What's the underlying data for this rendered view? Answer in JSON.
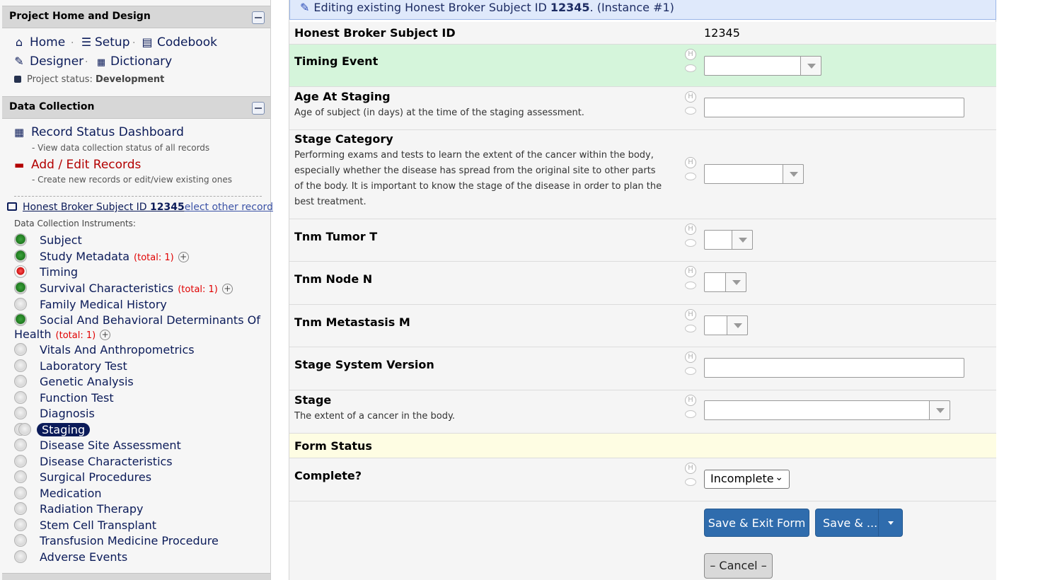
{
  "sidebar": {
    "project_header": "Project Home and Design",
    "links": {
      "home": "Home",
      "setup": "Setup",
      "codebook": "Codebook",
      "designer": "Designer",
      "dictionary": "Dictionary"
    },
    "separator": "·",
    "project_status_label": "Project status:",
    "project_status_value": "Development",
    "data_collection_header": "Data Collection",
    "record_status_dashboard": "Record Status Dashboard",
    "record_status_desc": "- View data collection status of all records",
    "add_edit_records": "Add / Edit Records",
    "add_edit_desc": "- Create new records or edit/view existing ones",
    "record_link_prefix": "Honest Broker Subject ID ",
    "record_id": "12345",
    "select_other": "elect other record",
    "instruments_caption": "Data Collection Instruments:",
    "instruments": [
      {
        "name": "Subject",
        "status": "green",
        "total": ""
      },
      {
        "name": "Study Metadata",
        "status": "green",
        "total": "(total: 1)"
      },
      {
        "name": "Timing",
        "status": "red",
        "total": ""
      },
      {
        "name": "Survival Characteristics",
        "status": "green",
        "total": "(total: 1)"
      },
      {
        "name": "Family Medical History",
        "status": "grey",
        "total": ""
      },
      {
        "name": "Social And Behavioral Determinants Of",
        "name2": "Health",
        "status": "green",
        "total": "(total: 1)"
      },
      {
        "name": "Vitals And Anthropometrics",
        "status": "grey",
        "total": ""
      },
      {
        "name": "Laboratory Test",
        "status": "grey",
        "total": ""
      },
      {
        "name": "Genetic Analysis",
        "status": "grey",
        "total": ""
      },
      {
        "name": "Function Test",
        "status": "grey",
        "total": ""
      },
      {
        "name": "Diagnosis",
        "status": "grey",
        "total": ""
      },
      {
        "name": "Staging",
        "status": "grey-active",
        "total": ""
      },
      {
        "name": "Disease Site Assessment",
        "status": "grey",
        "total": ""
      },
      {
        "name": "Disease Characteristics",
        "status": "grey",
        "total": ""
      },
      {
        "name": "Surgical Procedures",
        "status": "grey",
        "total": ""
      },
      {
        "name": "Medication",
        "status": "grey",
        "total": ""
      },
      {
        "name": "Radiation Therapy",
        "status": "grey",
        "total": ""
      },
      {
        "name": "Stem Cell Transplant",
        "status": "grey",
        "total": ""
      },
      {
        "name": "Transfusion Medicine Procedure",
        "status": "grey",
        "total": ""
      },
      {
        "name": "Adverse Events",
        "status": "grey",
        "total": ""
      }
    ],
    "plus": "+"
  },
  "form": {
    "banner_prefix": "Editing existing Honest Broker Subject ID ",
    "banner_id": "12345",
    "banner_suffix": ". (Instance #1)",
    "record_id_label": "Honest Broker Subject ID",
    "record_id_value": "12345",
    "fields": {
      "timing_event": {
        "label": "Timing Event"
      },
      "age_at_staging": {
        "label": "Age At Staging",
        "note": "Age of subject (in days) at the time of the staging assessment."
      },
      "stage_category": {
        "label": "Stage Category",
        "note": "Performing exams and tests to learn the extent of the cancer within the body, especially whether the disease has spread from the original site to other parts of the body. It is important to know the stage of the disease in order to plan the best treatment."
      },
      "tnm_tumor": {
        "label": "Tnm Tumor T"
      },
      "tnm_node": {
        "label": "Tnm Node N"
      },
      "tnm_metastasis": {
        "label": "Tnm Metastasis M"
      },
      "stage_system_version": {
        "label": "Stage System Version"
      },
      "stage": {
        "label": "Stage",
        "note": "The extent of a cancer in the body."
      }
    },
    "form_status_header": "Form Status",
    "complete_label": "Complete?",
    "complete_value": "Incomplete",
    "help_icon_letter": "H",
    "buttons": {
      "save_exit": "Save & Exit Form",
      "save_more": "Save & ...",
      "cancel": "– Cancel –"
    }
  },
  "colors": {
    "accent_navy": "#0b1b59",
    "button_blue": "#2f6cad",
    "timing_row_green": "#d5f5db",
    "form_status_yellow": "#fefde3",
    "banner_blue": "#dfe9fb"
  }
}
